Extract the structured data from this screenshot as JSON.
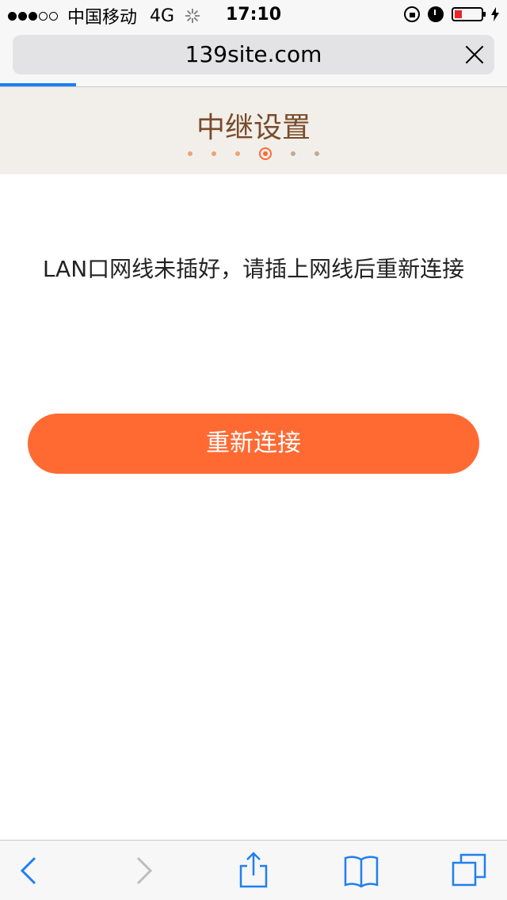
{
  "status_bar": {
    "carrier": "中国移动",
    "network": "4G",
    "time": "17:10"
  },
  "browser": {
    "url": "139site.com",
    "load_progress": 0.15
  },
  "header": {
    "title": "中继设置",
    "steps_total": 6,
    "active_step": 4
  },
  "main": {
    "message": "LAN口网线未插好，请插上网线后重新连接",
    "reconnect_label": "重新连接"
  },
  "toolbar": {
    "icons": [
      "back-icon",
      "forward-icon",
      "share-icon",
      "bookmarks-icon",
      "tabs-icon"
    ]
  },
  "colors": {
    "accent": "#ff6a33",
    "header_bg": "#f2efea",
    "title": "#7a4b2b",
    "ios_blue": "#1f7ff0"
  }
}
